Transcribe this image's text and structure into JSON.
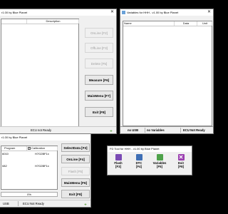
{
  "window1": {
    "title": "r1.00 by Blue Planet",
    "close": "✕",
    "columns": [
      "",
      "Description"
    ],
    "buttons": {
      "online": "OnLine [F2]",
      "offline": "OffLine [F3]",
      "delete": "Delete [F5]",
      "measure": "Measure [F6]",
      "mainmenu": "MainMenu [F7]",
      "exit": "Exit [F8]"
    },
    "status": "ECU not Ready"
  },
  "window2": {
    "title": "Variables for HHH - v1.00 by Blue Planet",
    "close": "✕",
    "columns": [
      "Name",
      "Data",
      "Unit"
    ],
    "status": [
      "no USB",
      "no Variables",
      "ECU Not Ready"
    ]
  },
  "window3": {
    "title": "r1.00 by Blue Planet",
    "close": "✕",
    "columns": [
      "Program",
      "Calibration"
    ],
    "rows": [
      {
        "program": "6010",
        "calibration": "H7G2BF1x"
      },
      {
        "program": "082",
        "calibration": "H7G2BF1x"
      }
    ],
    "progress_text": "0%",
    "buttons": {
      "selectdata": "SelectData [F3]",
      "online": "OnLine [F4]",
      "flash": "Flash [F5]",
      "mainmenu": "MainMenu [F6]",
      "exit": "Exit [F8]"
    },
    "status": [
      "USB",
      "ECU Not Ready"
    ]
  },
  "window4": {
    "title": "FD Tool for HHH - v1.00 by Blue Planet",
    "tools": [
      {
        "label1": "Flash",
        "label2": "[F3]",
        "icon": "flash-icon",
        "color": "#7b4bb5"
      },
      {
        "label1": "DTC",
        "label2": "[F4]",
        "icon": "dtc-icon",
        "color": "#3f6fb5"
      },
      {
        "label1": "Variables",
        "label2": "[F5]",
        "icon": "variables-icon",
        "color": "#4ea24a"
      },
      {
        "label1": "Exit",
        "label2": "[F8]",
        "icon": "exit-icon",
        "color": "#9b3fb0"
      }
    ]
  }
}
